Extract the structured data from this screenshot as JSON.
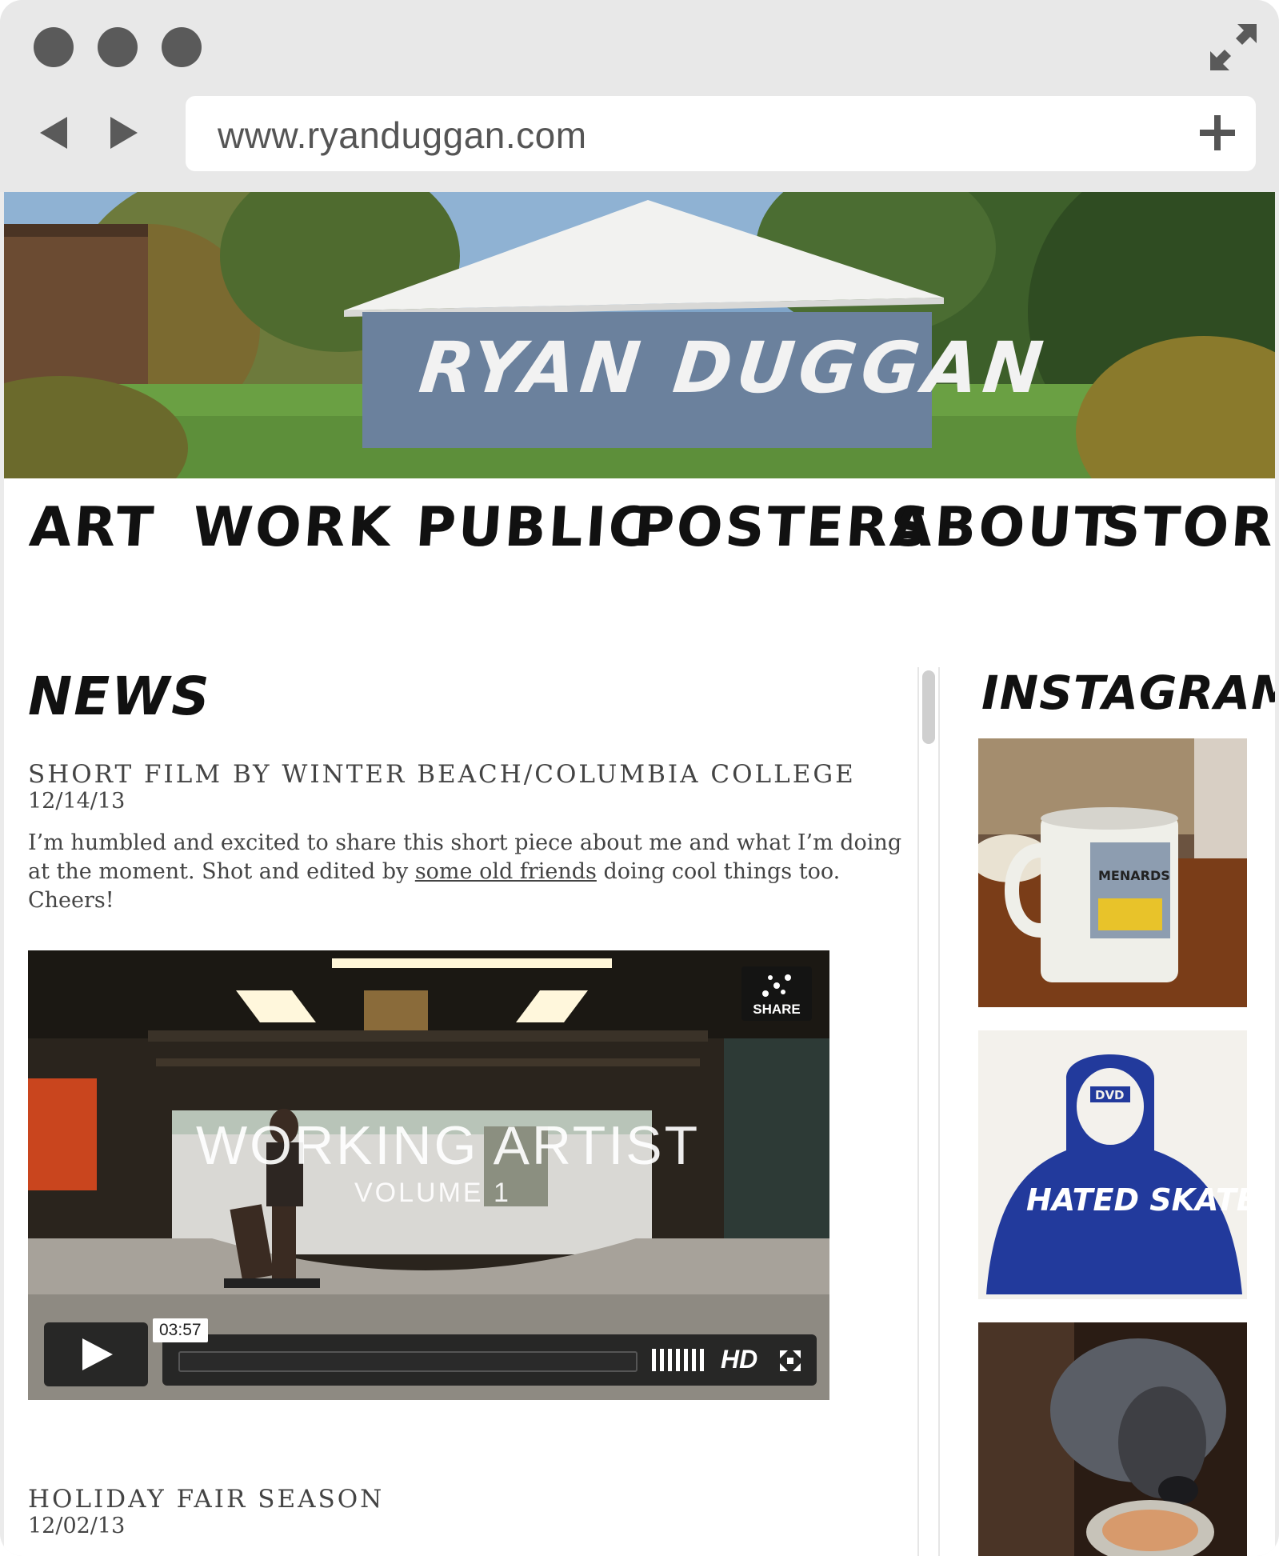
{
  "browser": {
    "url": "www.ryanduggan.com"
  },
  "site": {
    "title": "RYAN DUGGAN",
    "nav": [
      "ART",
      "WORK",
      "PUBLIC",
      "POSTERS",
      "ABOUT",
      "STORE"
    ]
  },
  "news": {
    "heading": "NEWS",
    "posts": [
      {
        "title": "SHORT FILM BY WINTER BEACH/COLUMBIA COLLEGE",
        "date": "12/14/13",
        "body_before": "I’m humbled and excited to share this short piece about me and what I’m doing at the moment. Shot and edited by ",
        "link_text": "some old friends",
        "body_after": " doing cool things too. Cheers!",
        "video": {
          "title": "WORKING ARTIST",
          "subtitle": "VOLUME 1",
          "share_label": "SHARE",
          "duration": "03:57",
          "hd_label": "HD"
        }
      },
      {
        "title": "HOLIDAY FAIR SEASON",
        "date": "12/02/13"
      }
    ]
  },
  "instagram": {
    "heading": "INSTAGRAM",
    "images": [
      {
        "icon": "mug-photo",
        "text": "MENARDS"
      },
      {
        "icon": "hated-skates-print",
        "text": "HATED SKATES",
        "badge": "DVD"
      },
      {
        "icon": "dog-photo"
      }
    ]
  }
}
